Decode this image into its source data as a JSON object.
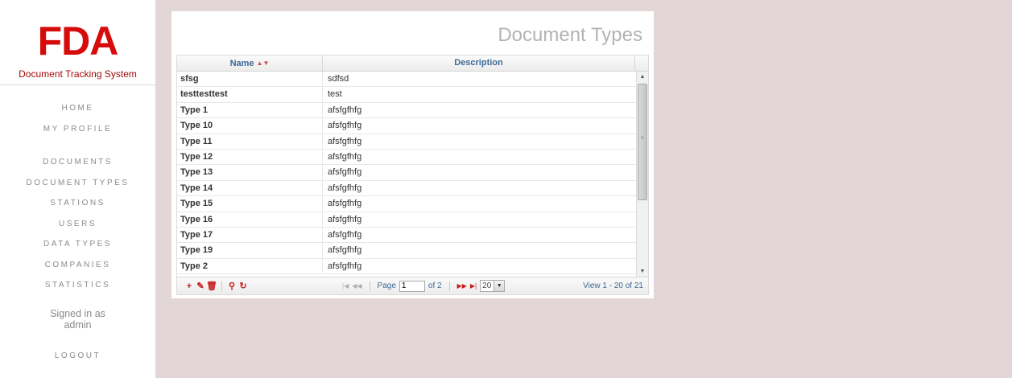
{
  "sidebar": {
    "logo_title": "FDA",
    "logo_subtitle": "Document Tracking System",
    "nav_group_1": [
      {
        "label": "HOME"
      },
      {
        "label": "MY PROFILE"
      }
    ],
    "nav_group_2": [
      {
        "label": "DOCUMENTS"
      },
      {
        "label": "DOCUMENT TYPES"
      },
      {
        "label": "STATIONS"
      },
      {
        "label": "USERS"
      },
      {
        "label": "DATA TYPES"
      },
      {
        "label": "COMPANIES"
      },
      {
        "label": "STATISTICS"
      }
    ],
    "signed_in_label": "Signed in as",
    "signed_in_user": "admin",
    "logout_label": "LOGOUT"
  },
  "main": {
    "title": "Document Types",
    "grid": {
      "columns": {
        "name": "Name",
        "description": "Description"
      },
      "sort_indicator": "▲▼",
      "rows": [
        {
          "name": "sfsg",
          "description": "sdfsd"
        },
        {
          "name": "testtesttest",
          "description": "test"
        },
        {
          "name": "Type 1",
          "description": "afsfgfhfg"
        },
        {
          "name": "Type 10",
          "description": "afsfgfhfg"
        },
        {
          "name": "Type 11",
          "description": "afsfgfhfg"
        },
        {
          "name": "Type 12",
          "description": "afsfgfhfg"
        },
        {
          "name": "Type 13",
          "description": "afsfgfhfg"
        },
        {
          "name": "Type 14",
          "description": "afsfgfhfg"
        },
        {
          "name": "Type 15",
          "description": "afsfgfhfg"
        },
        {
          "name": "Type 16",
          "description": "afsfgfhfg"
        },
        {
          "name": "Type 17",
          "description": "afsfgfhfg"
        },
        {
          "name": "Type 19",
          "description": "afsfgfhfg"
        },
        {
          "name": "Type 2",
          "description": "afsfgfhfg"
        }
      ]
    },
    "pager": {
      "actions": [
        "add-icon",
        "edit-icon",
        "delete-icon",
        "search-icon",
        "refresh-icon"
      ],
      "page_label": "Page",
      "page_value": "1",
      "of_label": "of 2",
      "rows_per_page": "20",
      "view_info": "View 1 - 20 of 21"
    }
  },
  "colors": {
    "background": "#e3d6d6",
    "logo_red": "#d60c0c",
    "header_text": "#3e6a97",
    "action_red": "#c5201f"
  }
}
